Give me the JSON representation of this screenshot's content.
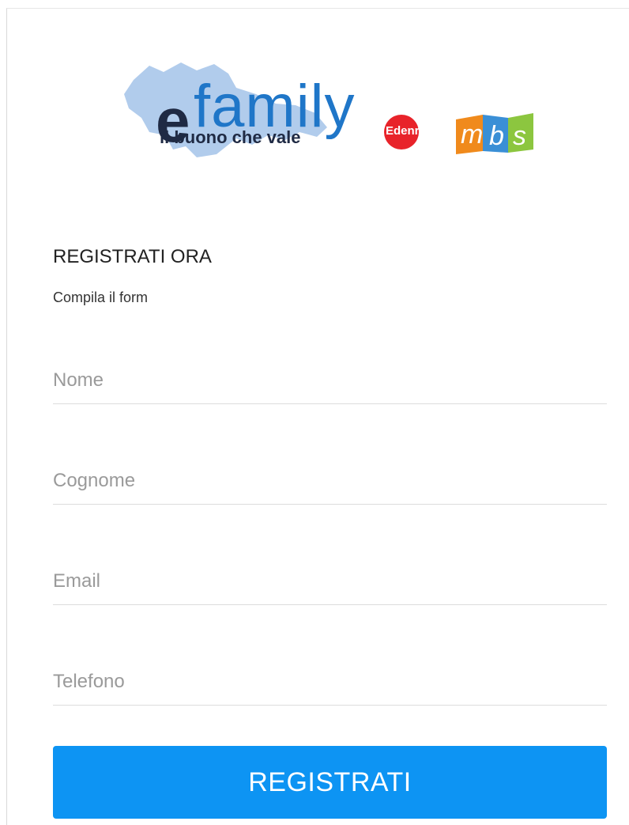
{
  "logo": {
    "brand_e": "e",
    "brand_rest": "family",
    "tagline": "il buono che vale",
    "partner1": "Edenred",
    "partner2": "mbs",
    "colors": {
      "map": "#a9c6ea",
      "brand_dark": "#1f2a44",
      "brand_blue": "#1f76c8",
      "edenred_red": "#e8232a",
      "mbs_orange": "#f08a1c",
      "mbs_blue": "#3a8fd6",
      "mbs_green": "#8cc63f"
    }
  },
  "form": {
    "headline": "REGISTRATI ORA",
    "subline": "Compila il form",
    "fields": [
      {
        "name": "nome",
        "placeholder": "Nome",
        "value": ""
      },
      {
        "name": "cognome",
        "placeholder": "Cognome",
        "value": ""
      },
      {
        "name": "email",
        "placeholder": "Email",
        "value": ""
      },
      {
        "name": "telefono",
        "placeholder": "Telefono",
        "value": ""
      }
    ],
    "submit_label": "REGISTRATI",
    "submit_color": "#0d94f3"
  }
}
